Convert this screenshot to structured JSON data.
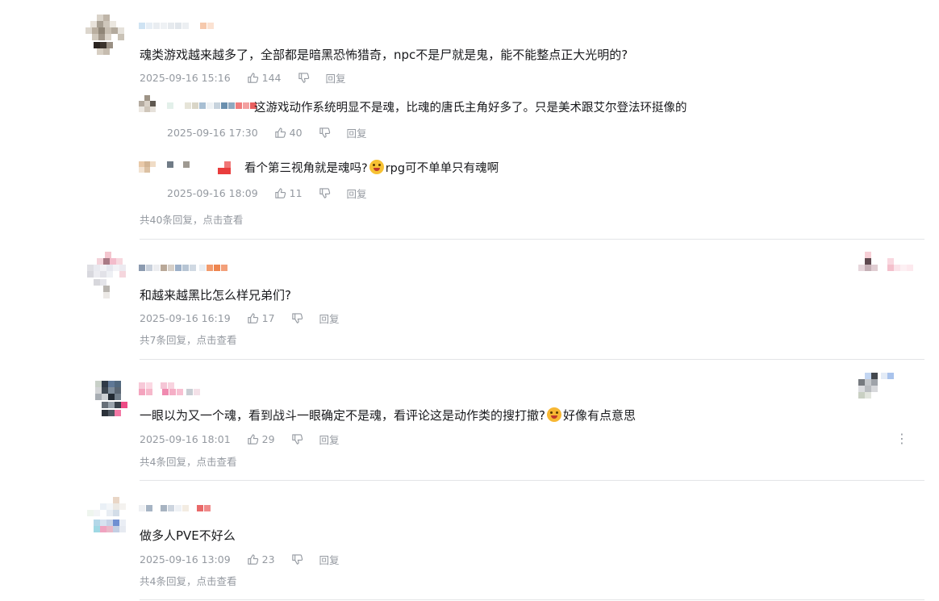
{
  "comments": [
    {
      "text": "魂类游戏越来越多了，全部都是暗黑恐怖猎奇，npc不是尸就是鬼，能不能整点正大光明的?",
      "time": "2025-09-16 15:16",
      "likes": "144",
      "reply_label": "回复",
      "more": "共40条回复，点击查看",
      "replies": [
        {
          "text": "这游戏动作系统明显不是魂，比魂的唐氏主角好多了。只是美术跟艾尔登法环挺像的",
          "time": "2025-09-16 17:30",
          "likes": "40",
          "reply_label": "回复"
        },
        {
          "text_before": "看个第三视角就是魂吗?",
          "emoji": "emoji-surprised-icon",
          "text_after": "rpg可不单单只有魂啊",
          "time": "2025-09-16 18:09",
          "likes": "11",
          "reply_label": "回复"
        }
      ]
    },
    {
      "text": "和越来越黑比怎么样兄弟们?",
      "time": "2025-09-16 16:19",
      "likes": "17",
      "reply_label": "回复",
      "more": "共7条回复，点击查看"
    },
    {
      "text_before": "一眼以为又一个魂，看到战斗一眼确定不是魂，看评论这是动作类的搜打撤?",
      "emoji": "emoji-laughing-icon",
      "text_after": "好像有点意思",
      "time": "2025-09-16 18:01",
      "likes": "29",
      "reply_label": "回复",
      "more": "共4条回复，点击查看"
    },
    {
      "text": "做多人PVE不好么",
      "time": "2025-09-16 13:09",
      "likes": "23",
      "reply_label": "回复",
      "more": "共4条回复，点击查看"
    }
  ],
  "icons": {
    "like": "thumbs-up-icon",
    "dislike": "thumbs-down-icon",
    "more": "more-vertical-icon"
  },
  "colors": {
    "text": "#18191c",
    "meta": "#9499a0",
    "divider": "#e3e5e7"
  }
}
